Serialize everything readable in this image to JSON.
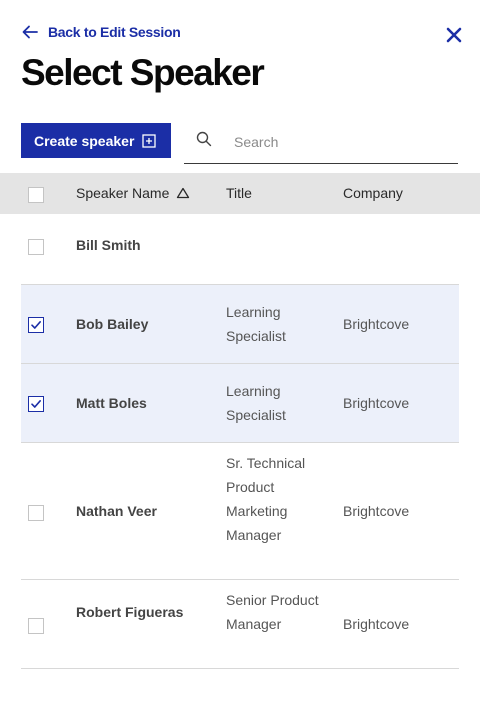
{
  "header": {
    "back_label": "Back to Edit Session",
    "title": "Select Speaker"
  },
  "toolbar": {
    "create_label": "Create speaker",
    "search_placeholder": "Search"
  },
  "table": {
    "columns": [
      "Speaker Name",
      "Title",
      "Company"
    ],
    "sort_column": "Speaker Name",
    "rows": [
      {
        "name": "Bill Smith",
        "title": "",
        "company": "",
        "checked": false
      },
      {
        "name": "Bob Bailey",
        "title": "Learning Specialist",
        "company": "Brightcove",
        "checked": true
      },
      {
        "name": "Matt Boles",
        "title": "Learning Specialist",
        "company": "Brightcove",
        "checked": true
      },
      {
        "name": "Nathan Veer",
        "title": "Sr. Technical Product Marketing Manager",
        "company": "Brightcove",
        "checked": false
      },
      {
        "name": "Robert Figueras",
        "title": "Senior Product Manager",
        "company": "Brightcove",
        "checked": false
      }
    ]
  },
  "colors": {
    "accent": "#1b2ea6",
    "header_bg": "#e4e4e4",
    "selected_row_bg": "#ecf0fa"
  },
  "icons": [
    "arrow-left-icon",
    "close-icon",
    "add-box-icon",
    "search-icon",
    "sort-triangle-icon",
    "checkmark-icon"
  ]
}
